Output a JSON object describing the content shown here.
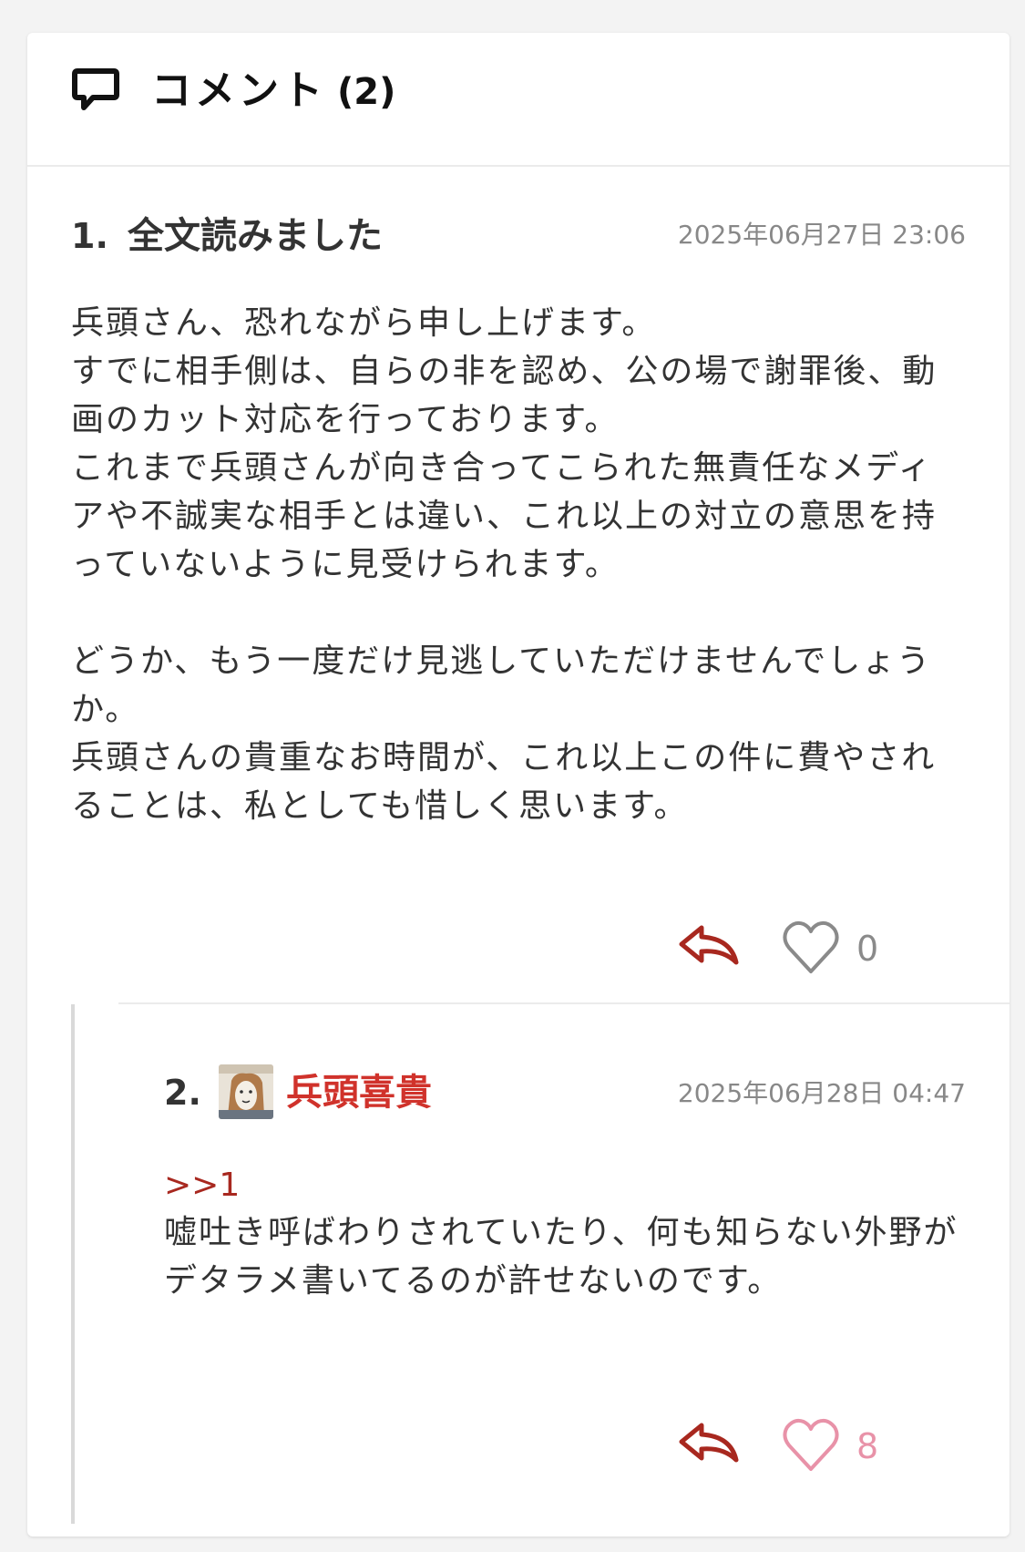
{
  "header": {
    "title": "コメント",
    "count": "(2)",
    "icon": "comment-bubble-icon"
  },
  "comments": [
    {
      "number": "1.",
      "title": "全文読みました",
      "date": "2025年06月27日 23:06",
      "body": "兵頭さん、恐れながら申し上げます。\nすでに相手側は、自らの非を認め、公の場で謝罪後、動画のカット対応を行っております。\nこれまで兵頭さんが向き合ってこられた無責任なメディアや不誠実な相手とは違い、これ以上の対立の意思を持っていないように見受けられます。\n\nどうか、もう一度だけ見逃していただけませんでしょうか。\n兵頭さんの貴重なお時間が、これ以上この件に費やされることは、私としても惜しく思います。",
      "likes": "0",
      "reply_icon": "reply-arrow-icon",
      "like_icon": "heart-icon"
    },
    {
      "number": "2.",
      "author": "兵頭喜貴",
      "date": "2025年06月28日 04:47",
      "anchor": ">>1",
      "body": "嘘吐き呼ばわりされていたり、何も知らない外野がデタラメ書いてるのが許せないのです。",
      "likes": "8",
      "reply_icon": "reply-arrow-icon",
      "like_icon": "heart-icon"
    }
  ],
  "colors": {
    "author_name": "#d0322b",
    "reply_arrow": "#a8281f",
    "heart_inactive": "#8a8a8a",
    "heart_active": "#e892a8"
  }
}
